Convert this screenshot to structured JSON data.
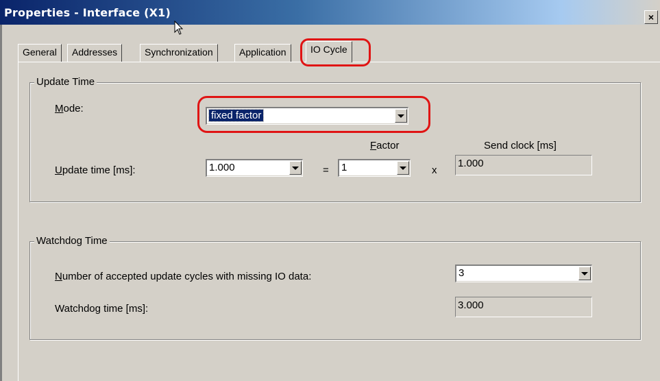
{
  "window": {
    "title": "Properties - Interface (X1)",
    "close_label": "×"
  },
  "tabs": [
    {
      "label": "General"
    },
    {
      "label": "Addresses"
    },
    {
      "label": "Synchronization"
    },
    {
      "label": "Application"
    },
    {
      "label": "IO Cycle",
      "active": true
    }
  ],
  "update_time": {
    "legend": "Update Time",
    "mode_label": "Mode:",
    "mode_value": "fixed factor",
    "factor_header": "Factor",
    "send_clock_header": "Send clock [ms]",
    "update_time_label": "Update time [ms]:",
    "update_time_value": "1.000",
    "equals": "=",
    "factor_value": "1",
    "times": "x",
    "send_clock_value": "1.000"
  },
  "watchdog": {
    "legend": "Watchdog Time",
    "cycles_label": "Number of accepted update cycles with missing IO data:",
    "cycles_value": "3",
    "watchdog_label": "Watchdog time [ms]:",
    "watchdog_value": "3.000"
  },
  "highlight_color": "#e01414"
}
